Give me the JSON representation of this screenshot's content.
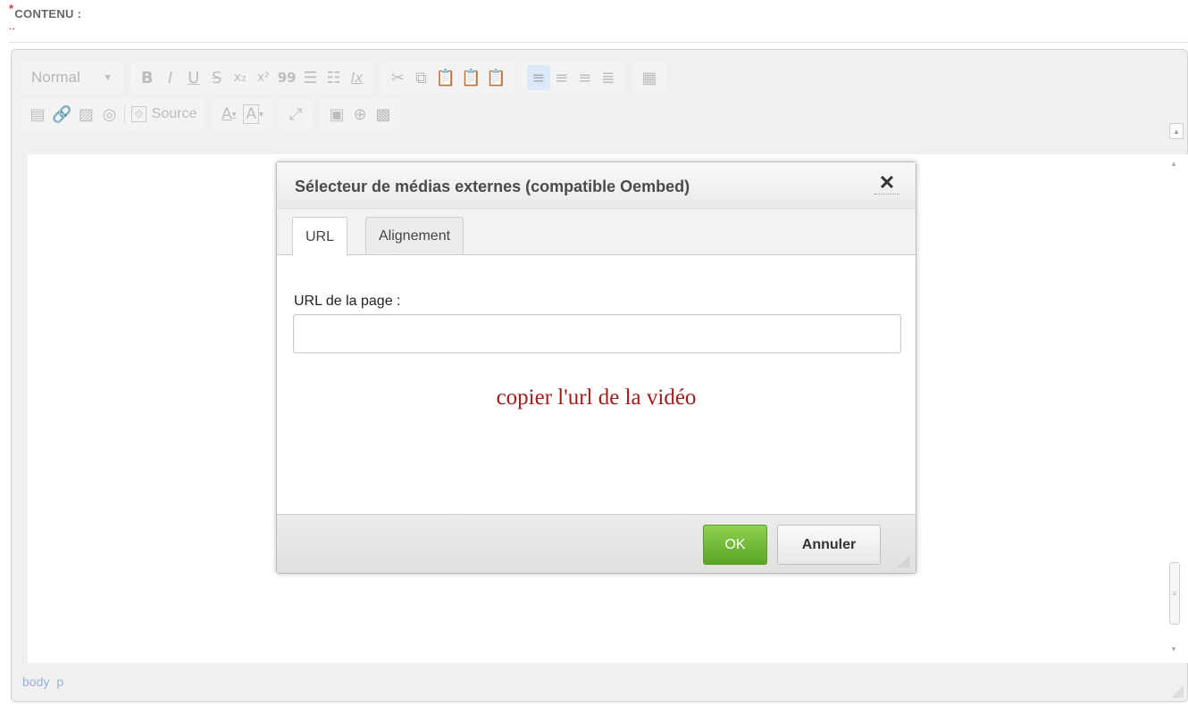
{
  "field": {
    "required_mark": "*",
    "label": "CONTENU :"
  },
  "toolbar": {
    "format_combo": "Normal",
    "bold": "B",
    "italic": "I",
    "underline": "U",
    "strike": "S",
    "subscript": "x₂",
    "superscript": "x²",
    "blockquote": "99",
    "numbered_list": "☰",
    "bullet_list": "☷",
    "remove_format": "Ix",
    "source_label": "Source",
    "text_color": "A",
    "bg_color": "A"
  },
  "dialog": {
    "title": "Sélecteur de médias externes (compatible Oembed)",
    "close": "✕",
    "tabs": [
      {
        "label": "URL",
        "active": true
      },
      {
        "label": "Alignement",
        "active": false
      }
    ],
    "url_label": "URL de la page :",
    "url_value": "",
    "hint": "copier l'url de la vidéo",
    "ok_label": "OK",
    "cancel_label": "Annuler"
  },
  "statusbar": {
    "path": [
      "body",
      "p"
    ]
  },
  "colors": {
    "accent_green": "#6ab63a",
    "hint_red": "#a01c1c",
    "active_blue": "#dbe9f8"
  }
}
